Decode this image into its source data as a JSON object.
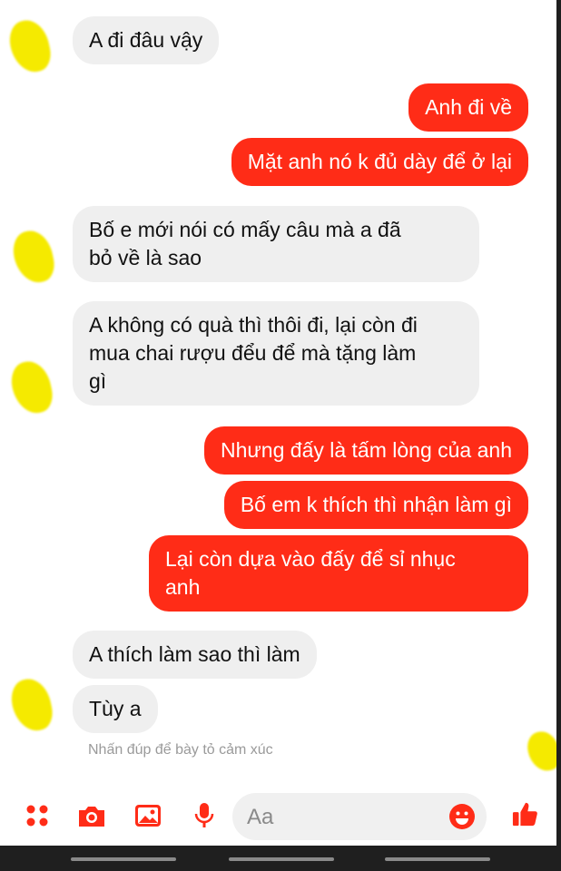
{
  "messages": [
    {
      "from": "them",
      "text": "A đi đâu vậy"
    },
    {
      "from": "me",
      "text": "Anh đi về"
    },
    {
      "from": "me",
      "text": "Mặt anh nó k đủ dày để ở lại"
    },
    {
      "from": "them",
      "text": "Bố e mới nói có mấy câu mà a đã\nbỏ về là sao"
    },
    {
      "from": "them",
      "text": "A không có quà thì thôi đi, lại còn đi\nmua chai rượu đểu để mà tặng làm\ngì"
    },
    {
      "from": "me",
      "text": "Nhưng đấy là tấm lòng của anh"
    },
    {
      "from": "me",
      "text": "Bố em k thích thì nhận làm gì"
    },
    {
      "from": "me",
      "text": "Lại còn dựa vào đấy để sỉ nhục\nanh"
    },
    {
      "from": "them",
      "text": "A thích làm sao thì làm"
    },
    {
      "from": "them",
      "text": "Tùy a"
    }
  ],
  "reaction_hint": "Nhấn đúp để bày tỏ cảm xúc",
  "composer": {
    "placeholder": "Aa",
    "icons": [
      "apps-icon",
      "camera-icon",
      "gallery-icon",
      "microphone-icon",
      "emoji-icon",
      "thumbs-up-icon"
    ]
  },
  "colors": {
    "sent_bubble": "#ff2c17",
    "received_bubble": "#efefef",
    "accent": "#ff2c17",
    "avatar_blur": "#f5ea00"
  }
}
